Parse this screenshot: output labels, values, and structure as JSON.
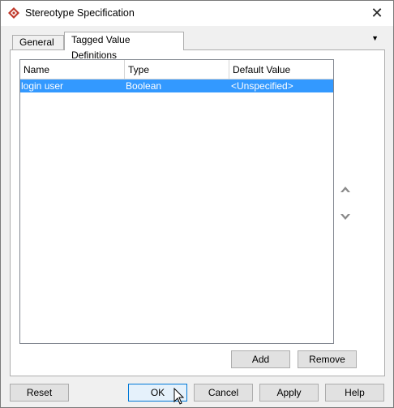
{
  "window": {
    "title": "Stereotype Specification",
    "close_label": "✕"
  },
  "tabs": [
    {
      "label": "General",
      "active": false
    },
    {
      "label": "Tagged Value Definitions",
      "active": true
    }
  ],
  "tab_menu_icon": "▼",
  "table": {
    "columns": [
      "Name",
      "Type",
      "Default Value"
    ],
    "rows": [
      {
        "name": "login user",
        "type": "Boolean",
        "default_value": "<Unspecified>",
        "selected": true
      }
    ]
  },
  "actions": {
    "add_label": "Add",
    "remove_label": "Remove"
  },
  "footer": {
    "reset_label": "Reset",
    "ok_label": "OK",
    "cancel_label": "Cancel",
    "apply_label": "Apply",
    "help_label": "Help"
  },
  "colors": {
    "selection": "#3399ff",
    "app_icon": "#c0392b",
    "arrow_icon": "#8a8a8a"
  }
}
